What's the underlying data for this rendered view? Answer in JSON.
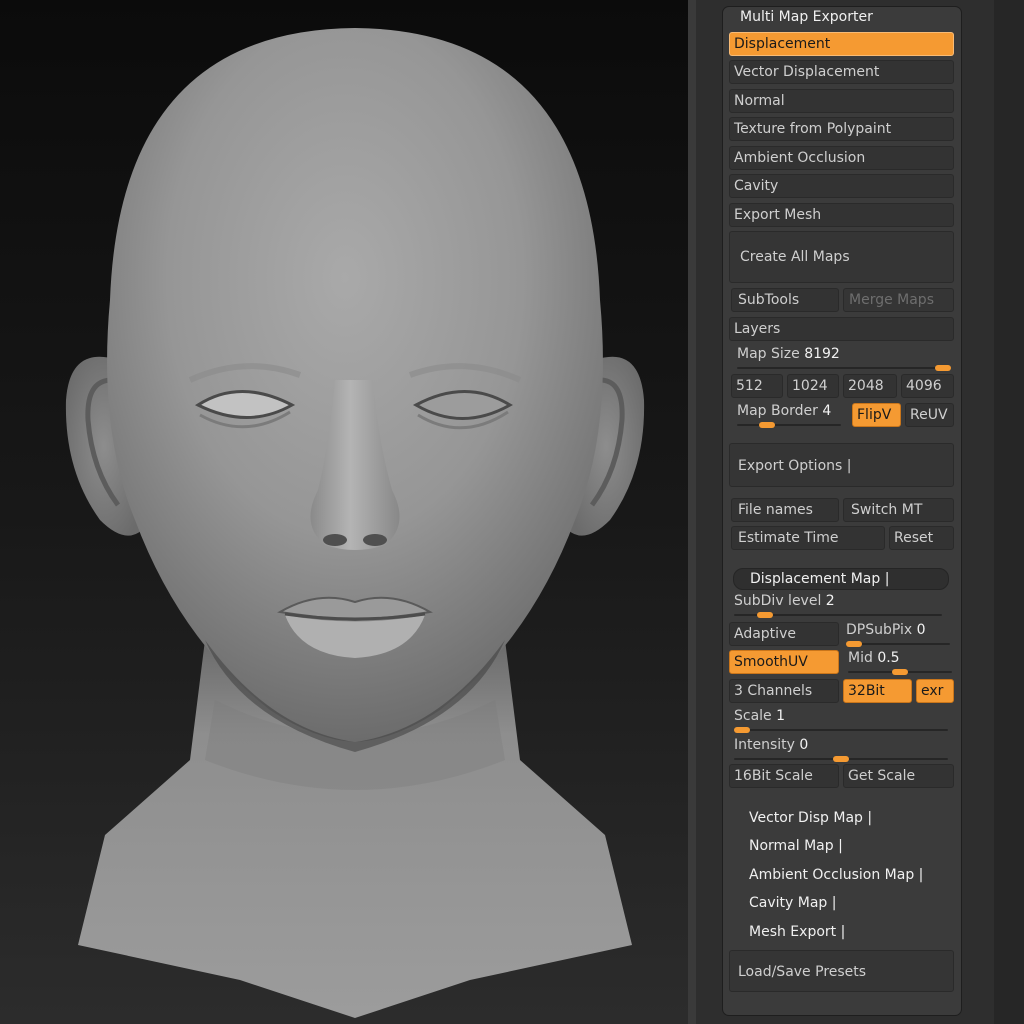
{
  "palette": {
    "title": "Multi Map Exporter",
    "maps": [
      {
        "label": "Displacement",
        "active": true
      },
      {
        "label": "Vector Displacement",
        "active": false
      },
      {
        "label": "Normal",
        "active": false
      },
      {
        "label": "Texture from Polypaint",
        "active": false
      },
      {
        "label": "Ambient Occlusion",
        "active": false
      },
      {
        "label": "Cavity",
        "active": false
      },
      {
        "label": "Export Mesh",
        "active": false
      }
    ],
    "create_all": "Create All Maps",
    "subtools": "SubTools",
    "merge_maps": "Merge Maps",
    "layers": "Layers",
    "map_size": {
      "label": "Map Size",
      "value": "8192",
      "level": 1.0
    },
    "size_presets": [
      "512",
      "1024",
      "2048",
      "4096"
    ],
    "map_border": {
      "label": "Map Border",
      "value": "4",
      "level": 0.25
    },
    "flipv": "FlipV",
    "reuv": "ReUV",
    "export_options": "Export Options |",
    "file_names": "File names",
    "switch_mt": "Switch MT",
    "estimate_time": "Estimate Time",
    "reset": "Reset",
    "displacement_map": {
      "header": "Displacement Map |",
      "subdiv": {
        "label": "SubDiv level",
        "value": "2",
        "level": 0.12
      },
      "adaptive": "Adaptive",
      "dpsubpix": {
        "label": "DPSubPix",
        "value": "0",
        "level": 0.0
      },
      "smoothuv": "SmoothUV",
      "mid": {
        "label": "Mid",
        "value": "0.5",
        "level": 0.5
      },
      "channels": "3 Channels",
      "bit32": "32Bit",
      "exr": "exr",
      "scale": {
        "label": "Scale",
        "value": "1",
        "level": 0.0
      },
      "intensity": {
        "label": "Intensity",
        "value": "0",
        "level": 0.5
      },
      "bit16_scale": "16Bit Scale",
      "get_scale": "Get Scale"
    },
    "subpalettes": [
      "Vector Disp Map |",
      "Normal Map |",
      "Ambient Occlusion Map |",
      "Cavity Map |",
      "Mesh Export |"
    ],
    "load_save": "Load/Save Presets"
  },
  "colors": {
    "accent": "#f59a32",
    "panel": "#3b3b3b",
    "button": "#333333"
  }
}
